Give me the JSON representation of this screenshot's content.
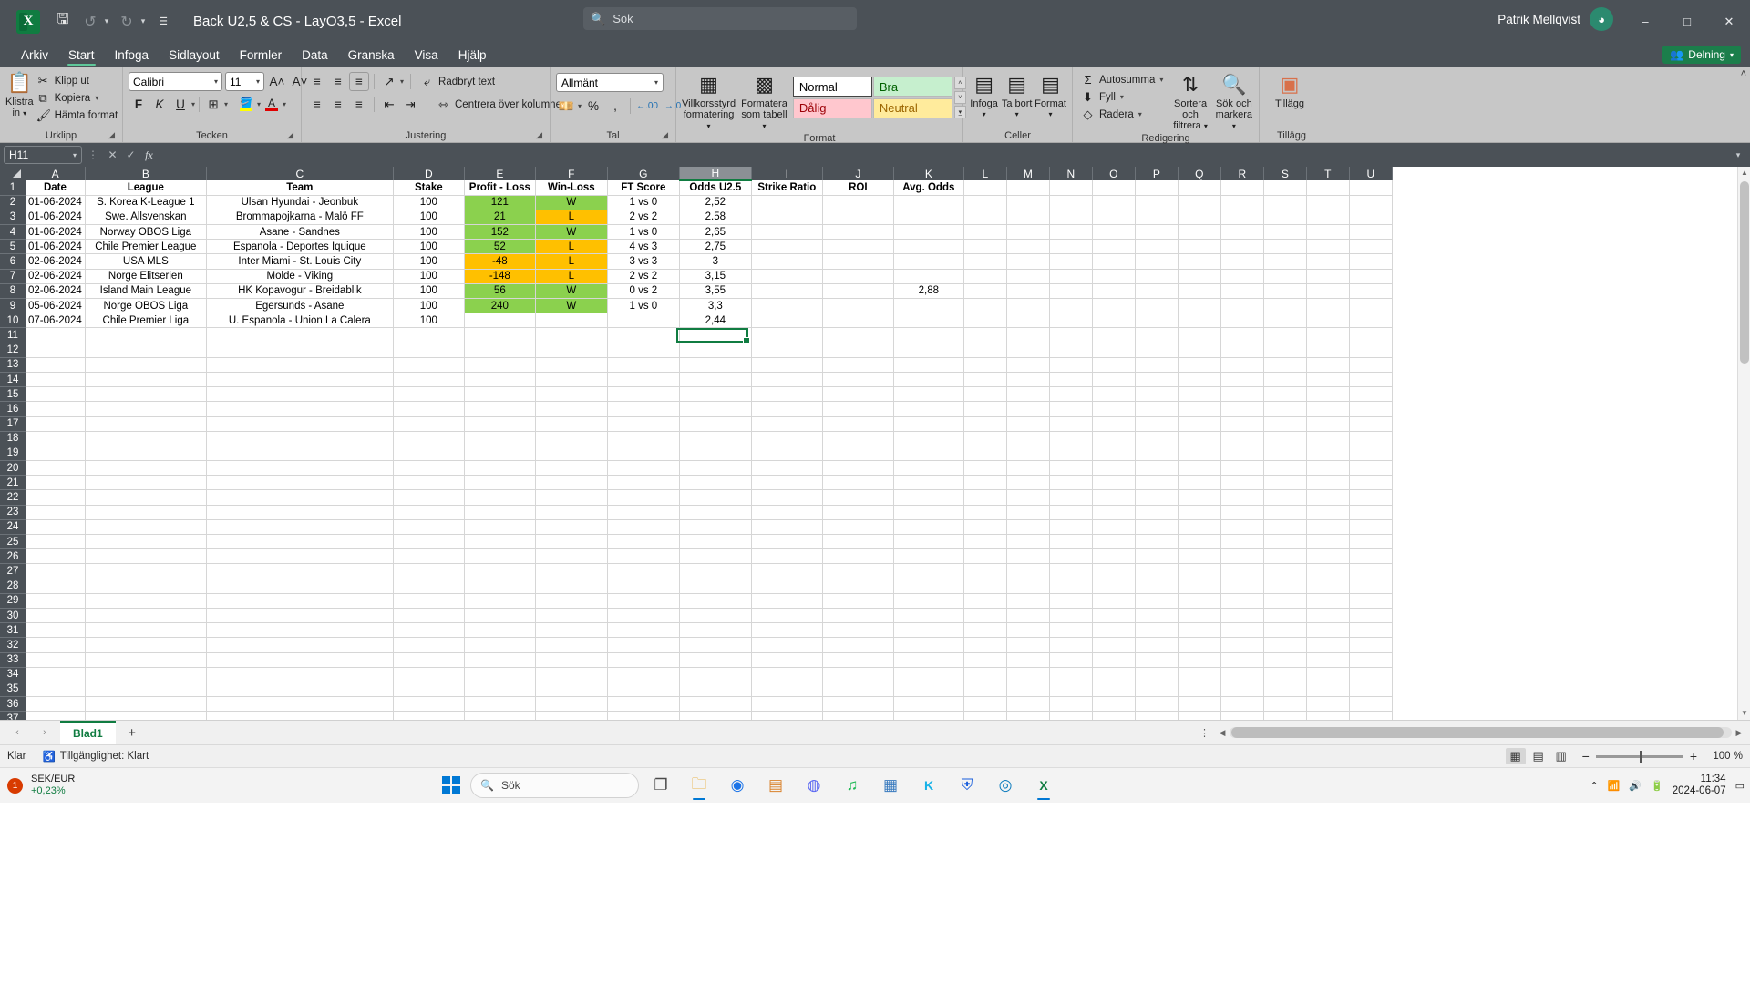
{
  "titlebar": {
    "app_logo": "excel-logo",
    "save_icon": "save-icon",
    "undo_icon": "undo-icon",
    "redo_icon": "redo-icon",
    "customize_icon": "customize-quick-access-icon",
    "title": "Back U2,5 & CS - LayO3,5  -  Excel",
    "search_placeholder": "Sök",
    "account_name": "Patrik Mellqvist",
    "avatar_initial": "",
    "minimize": "–",
    "maximize": "□",
    "close": "✕"
  },
  "menu": {
    "tabs": [
      {
        "label": "Arkiv",
        "active": false
      },
      {
        "label": "Start",
        "active": true
      },
      {
        "label": "Infoga",
        "active": false
      },
      {
        "label": "Sidlayout",
        "active": false
      },
      {
        "label": "Formler",
        "active": false
      },
      {
        "label": "Data",
        "active": false
      },
      {
        "label": "Granska",
        "active": false
      },
      {
        "label": "Visa",
        "active": false
      },
      {
        "label": "Hjälp",
        "active": false
      }
    ],
    "share_label": "Delning"
  },
  "ribbon": {
    "groups": [
      {
        "label": "Urklipp"
      },
      {
        "label": "Tecken"
      },
      {
        "label": "Justering"
      },
      {
        "label": "Tal"
      },
      {
        "label": "Format"
      },
      {
        "label": "Celler"
      },
      {
        "label": "Redigering"
      },
      {
        "label": "Tillägg"
      }
    ],
    "clipboard": {
      "paste_label": "Klistra\nin",
      "paste_line1": "Klistra",
      "paste_line2": "in",
      "cut": "Klipp ut",
      "copy": "Kopiera",
      "format_painter": "Hämta format"
    },
    "font": {
      "name": "Calibri",
      "size": "11",
      "grow_label": "A",
      "shrink_label": "A",
      "bold": "F",
      "italic": "K",
      "underline": "U"
    },
    "alignment": {
      "wrap_text": "Radbryt text",
      "merge_center": "Centrera över kolumner"
    },
    "number": {
      "format": "Allmänt",
      "percent": "%",
      "comma": "000"
    },
    "styles": {
      "conditional_l1": "Villkorsstyrd",
      "conditional_l2": "formatering",
      "table_l1": "Formatera",
      "table_l2": "som tabell",
      "cells": [
        "Normal",
        "Bra",
        "Dålig",
        "Neutral"
      ]
    },
    "cells": {
      "insert": "Infoga",
      "delete": "Ta bort",
      "format": "Format"
    },
    "editing": {
      "autosum": "Autosumma",
      "fill": "Fyll",
      "clear": "Radera",
      "sort_l1": "Sortera och",
      "sort_l2": "filtrera",
      "find_l1": "Sök och",
      "find_l2": "markera"
    },
    "addins": {
      "label": "Tillägg"
    }
  },
  "formula_bar": {
    "name_box": "H11",
    "cancel_icon": "cancel-icon",
    "confirm_icon": "confirm-icon",
    "function_icon": "fx",
    "value": ""
  },
  "grid": {
    "columns": [
      "A",
      "B",
      "C",
      "D",
      "E",
      "F",
      "G",
      "H",
      "I",
      "J",
      "K",
      "L",
      "M",
      "N",
      "O",
      "P",
      "Q",
      "R",
      "S",
      "T",
      "U"
    ],
    "selected_column": "H",
    "selected_cell": "H11",
    "visible_rows": 37,
    "headers": {
      "A": "Date",
      "B": "League",
      "C": "Team",
      "D": "Stake",
      "E": "Profit - Loss",
      "F": "Win-Loss",
      "G": "FT Score",
      "H": "Odds U2.5",
      "I": "Strike Ratio",
      "J": "ROI",
      "K": "Avg. Odds"
    },
    "rows": [
      {
        "r": 2,
        "date": "01-06-2024",
        "league": "S. Korea K-League 1",
        "team": "Ulsan Hyundai - Jeonbuk",
        "stake": "100",
        "profit": "121",
        "profit_fill": "green",
        "winloss": "W",
        "wl_fill": "green",
        "ft": "1 vs 0",
        "odds": "2,52",
        "strike": "",
        "roi": "",
        "avg": ""
      },
      {
        "r": 3,
        "date": "01-06-2024",
        "league": "Swe. Allsvenskan",
        "team": "Brommapojkarna - Malö FF",
        "stake": "100",
        "profit": "21",
        "profit_fill": "green",
        "winloss": "L",
        "wl_fill": "amber",
        "ft": "2 vs 2",
        "odds": "2.58",
        "strike": "",
        "roi": "",
        "avg": ""
      },
      {
        "r": 4,
        "date": "01-06-2024",
        "league": "Norway OBOS Liga",
        "team": "Asane - Sandnes",
        "stake": "100",
        "profit": "152",
        "profit_fill": "green",
        "winloss": "W",
        "wl_fill": "green",
        "ft": "1 vs 0",
        "odds": "2,65",
        "strike": "",
        "roi": "",
        "avg": ""
      },
      {
        "r": 5,
        "date": "01-06-2024",
        "league": "Chile Premier League",
        "team": "Espanola - Deportes Iquique",
        "stake": "100",
        "profit": "52",
        "profit_fill": "green",
        "winloss": "L",
        "wl_fill": "amber",
        "ft": "4 vs 3",
        "odds": "2,75",
        "strike": "",
        "roi": "",
        "avg": ""
      },
      {
        "r": 6,
        "date": "02-06-2024",
        "league": "USA MLS",
        "team": "Inter Miami - St. Louis City",
        "stake": "100",
        "profit": "-48",
        "profit_fill": "amber",
        "winloss": "L",
        "wl_fill": "amber",
        "ft": "3 vs 3",
        "odds": "3",
        "strike": "",
        "roi": "",
        "avg": ""
      },
      {
        "r": 7,
        "date": "02-06-2024",
        "league": "Norge Elitserien",
        "team": "Molde - Viking",
        "stake": "100",
        "profit": "-148",
        "profit_fill": "amber",
        "winloss": "L",
        "wl_fill": "amber",
        "ft": "2 vs 2",
        "odds": "3,15",
        "strike": "",
        "roi": "",
        "avg": ""
      },
      {
        "r": 8,
        "date": "02-06-2024",
        "league": "Island Main League",
        "team": "HK Kopavogur - Breidablik",
        "stake": "100",
        "profit": "56",
        "profit_fill": "green",
        "winloss": "W",
        "wl_fill": "green",
        "ft": "0 vs 2",
        "odds": "3,55",
        "strike": "",
        "roi": "",
        "avg": "2,88"
      },
      {
        "r": 9,
        "date": "05-06-2024",
        "league": "Norge OBOS Liga",
        "team": "Egersunds - Asane",
        "stake": "100",
        "profit": "240",
        "profit_fill": "green",
        "winloss": "W",
        "wl_fill": "green",
        "ft": "1 vs 0",
        "odds": "3,3",
        "strike": "",
        "roi": "",
        "avg": ""
      },
      {
        "r": 10,
        "date": "07-06-2024",
        "league": "Chile Premier Liga",
        "team": "U. Espanola - Union La Calera",
        "stake": "100",
        "profit": "",
        "profit_fill": "",
        "winloss": "",
        "wl_fill": "",
        "ft": "",
        "odds": "2,44",
        "strike": "",
        "roi": "",
        "avg": ""
      }
    ]
  },
  "sheets": {
    "prev_icon": "chevron-left-icon",
    "next_icon": "chevron-right-icon",
    "tabs": [
      {
        "label": "Blad1",
        "active": true
      }
    ],
    "add_label": "+"
  },
  "status_bar": {
    "ready": "Klar",
    "accessibility": "Tillgänglighet: Klart",
    "view_normal": "normal-view-icon",
    "view_pagelayout": "page-layout-view-icon",
    "view_pagebreak": "page-break-view-icon",
    "zoom": "100 %",
    "zoom_out": "−",
    "zoom_in": "+"
  },
  "taskbar": {
    "weather_badge": "1",
    "weather_line1": "SEK/EUR",
    "weather_line2": "+0,23%",
    "start_icon": "windows-start-icon",
    "search_placeholder": "Sök",
    "apps": [
      {
        "name": "task-view-icon",
        "glyph": "🗔"
      },
      {
        "name": "file-explorer-icon",
        "glyph": "📁"
      },
      {
        "name": "chrome-icon",
        "glyph": "◉"
      },
      {
        "name": "store-icon",
        "glyph": "▤"
      },
      {
        "name": "discord-icon",
        "glyph": "◍"
      },
      {
        "name": "spotify-icon",
        "glyph": "♫"
      },
      {
        "name": "calculator-icon",
        "glyph": "▦"
      },
      {
        "name": "kodi-icon",
        "glyph": "K"
      },
      {
        "name": "bitwarden-icon",
        "glyph": "⛨"
      },
      {
        "name": "edge-icon",
        "glyph": "◎"
      },
      {
        "name": "excel-taskbar-icon",
        "glyph": "X"
      }
    ],
    "tray": {
      "chevron": "⌃",
      "wifi": "wifi-icon",
      "sound": "sound-icon",
      "battery": "battery-icon"
    },
    "time": "11:34",
    "date": "2024-06-07"
  }
}
